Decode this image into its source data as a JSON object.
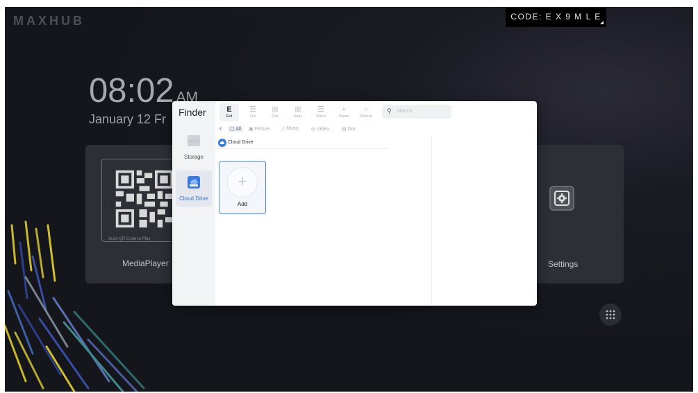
{
  "brand": "MAXHUB",
  "code_badge": {
    "label": "CODE: E X 9 M L E"
  },
  "clock": {
    "time": "08:02",
    "ampm": "AM",
    "date": "January 12 Fr"
  },
  "cards": {
    "media": {
      "label": "MediaPlayer",
      "scan_hint": "Scan QR Code to Play"
    },
    "settings": {
      "label": "Settings"
    }
  },
  "finder": {
    "title": "Finder",
    "sidebar": [
      {
        "label": "Storage",
        "icon": "storage-icon"
      },
      {
        "label": "Cloud Drive",
        "icon": "cloud-drive-icon",
        "selected": true
      }
    ],
    "toolbar": [
      {
        "label": "Exit",
        "glyph": "E"
      },
      {
        "label": "List",
        "glyph": "☰"
      },
      {
        "label": "Grid",
        "glyph": "⊞"
      },
      {
        "label": "Array",
        "glyph": "⊞"
      },
      {
        "label": "Select",
        "glyph": "☰"
      },
      {
        "label": "Create",
        "glyph": "+"
      },
      {
        "label": "Refresh",
        "glyph": "○"
      }
    ],
    "search_placeholder": "Search",
    "filters": [
      "All",
      "Picture",
      "Music",
      "Video",
      "Doc"
    ],
    "breadcrumb": "Cloud Drive",
    "add_tile_label": "Add"
  },
  "colors": {
    "accent": "#4a86e8",
    "background": "#15161c"
  }
}
